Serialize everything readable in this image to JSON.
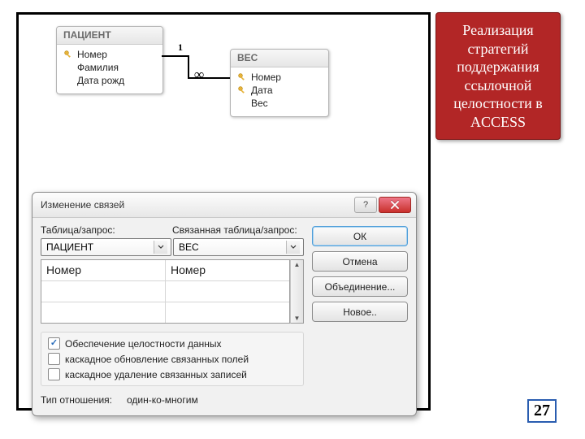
{
  "diagram": {
    "patient": {
      "title": "ПАЦИЕНТ",
      "fields": [
        "Номер",
        "Фамилия",
        "Дата рожд"
      ],
      "keys": [
        true,
        false,
        false
      ]
    },
    "ves": {
      "title": "ВЕС",
      "fields": [
        "Номер",
        "Дата",
        "Вес"
      ],
      "keys": [
        true,
        true,
        false
      ]
    },
    "relation": {
      "one": "1",
      "many": "∞"
    }
  },
  "dialog": {
    "title": "Изменение связей",
    "label_table": "Таблица/запрос:",
    "label_related": "Связанная таблица/запрос:",
    "combo_left": "ПАЦИЕНТ",
    "combo_right": "ВЕС",
    "grid": {
      "rows": [
        {
          "left": "Номер",
          "right": "Номер"
        },
        {
          "left": "",
          "right": ""
        },
        {
          "left": "",
          "right": ""
        }
      ]
    },
    "checks": {
      "integrity": {
        "label": "Обеспечение целостности данных",
        "checked": true
      },
      "cascade_update": {
        "label": "каскадное обновление связанных полей",
        "checked": false
      },
      "cascade_delete": {
        "label": "каскадное удаление связанных записей",
        "checked": false
      }
    },
    "type_label": "Тип отношения:",
    "type_value": "один-ко-многим",
    "buttons": {
      "ok": "ОК",
      "cancel": "Отмена",
      "join": "Объединение...",
      "new": "Новое.."
    },
    "help_icon": "?",
    "close_icon": "×"
  },
  "side_label": "Реализация стратегий поддержания ссылочной целостности в ACCESS",
  "page_number": "27"
}
